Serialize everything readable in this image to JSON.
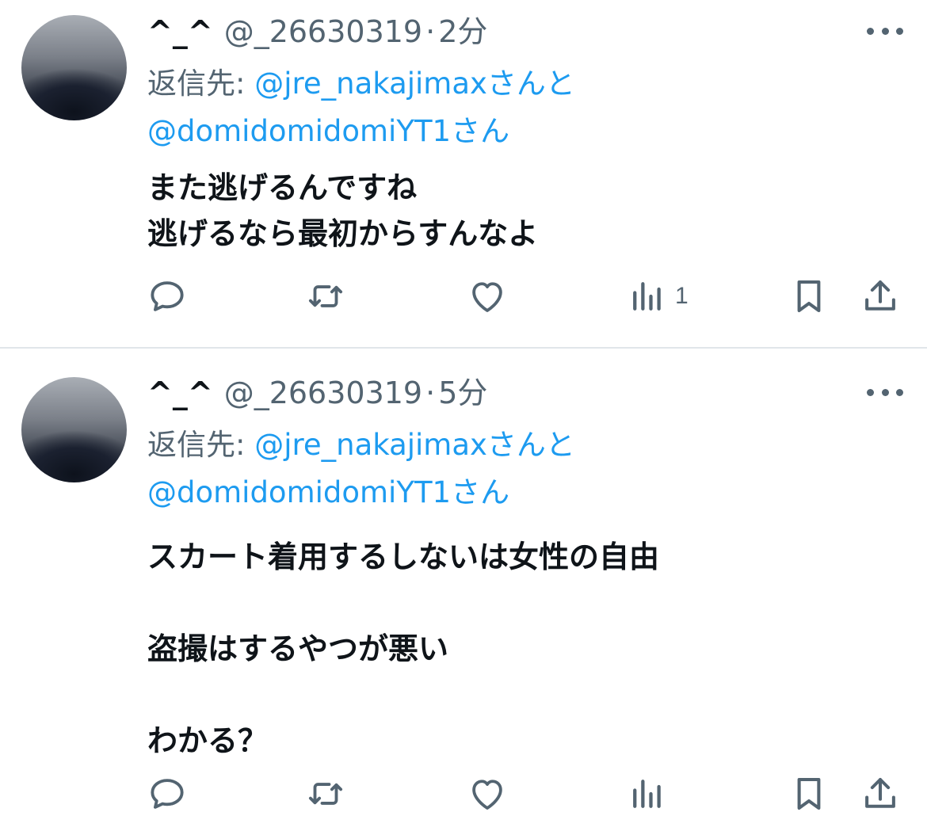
{
  "tweets": [
    {
      "display_name": "^_^",
      "handle": "@_26630319",
      "separator": "·",
      "time": "2分",
      "reply_prefix": "返信先:",
      "reply_mention_1": "@jre_nakajimax",
      "reply_joiner": "さんと",
      "reply_mention_2": "@domidomidomiYT1",
      "reply_suffix": "さん",
      "body": "また逃げるんですね\n逃げるなら最初からすんなよ",
      "views_count": "1"
    },
    {
      "display_name": "^_^",
      "handle": "@_26630319",
      "separator": "·",
      "time": "5分",
      "reply_prefix": "返信先:",
      "reply_mention_1": "@jre_nakajimax",
      "reply_joiner": "さんと",
      "reply_mention_2": "@domidomidomiYT1",
      "reply_suffix": "さん",
      "body": "スカート着用するしないは女性の自由\n\n盗撮はするやつが悪い\n\nわかる？",
      "views_count": ""
    }
  ],
  "icons": {
    "reply": "speech-bubble-icon",
    "retweet": "retweet-arrows-icon",
    "like": "heart-icon",
    "views": "bar-chart-icon",
    "bookmark": "bookmark-icon",
    "share": "share-upload-icon",
    "more": "ellipsis-icon"
  },
  "colors": {
    "text_primary": "#0f1419",
    "text_secondary": "#536471",
    "link": "#1d9bf0",
    "divider": "#e1e6ea"
  }
}
